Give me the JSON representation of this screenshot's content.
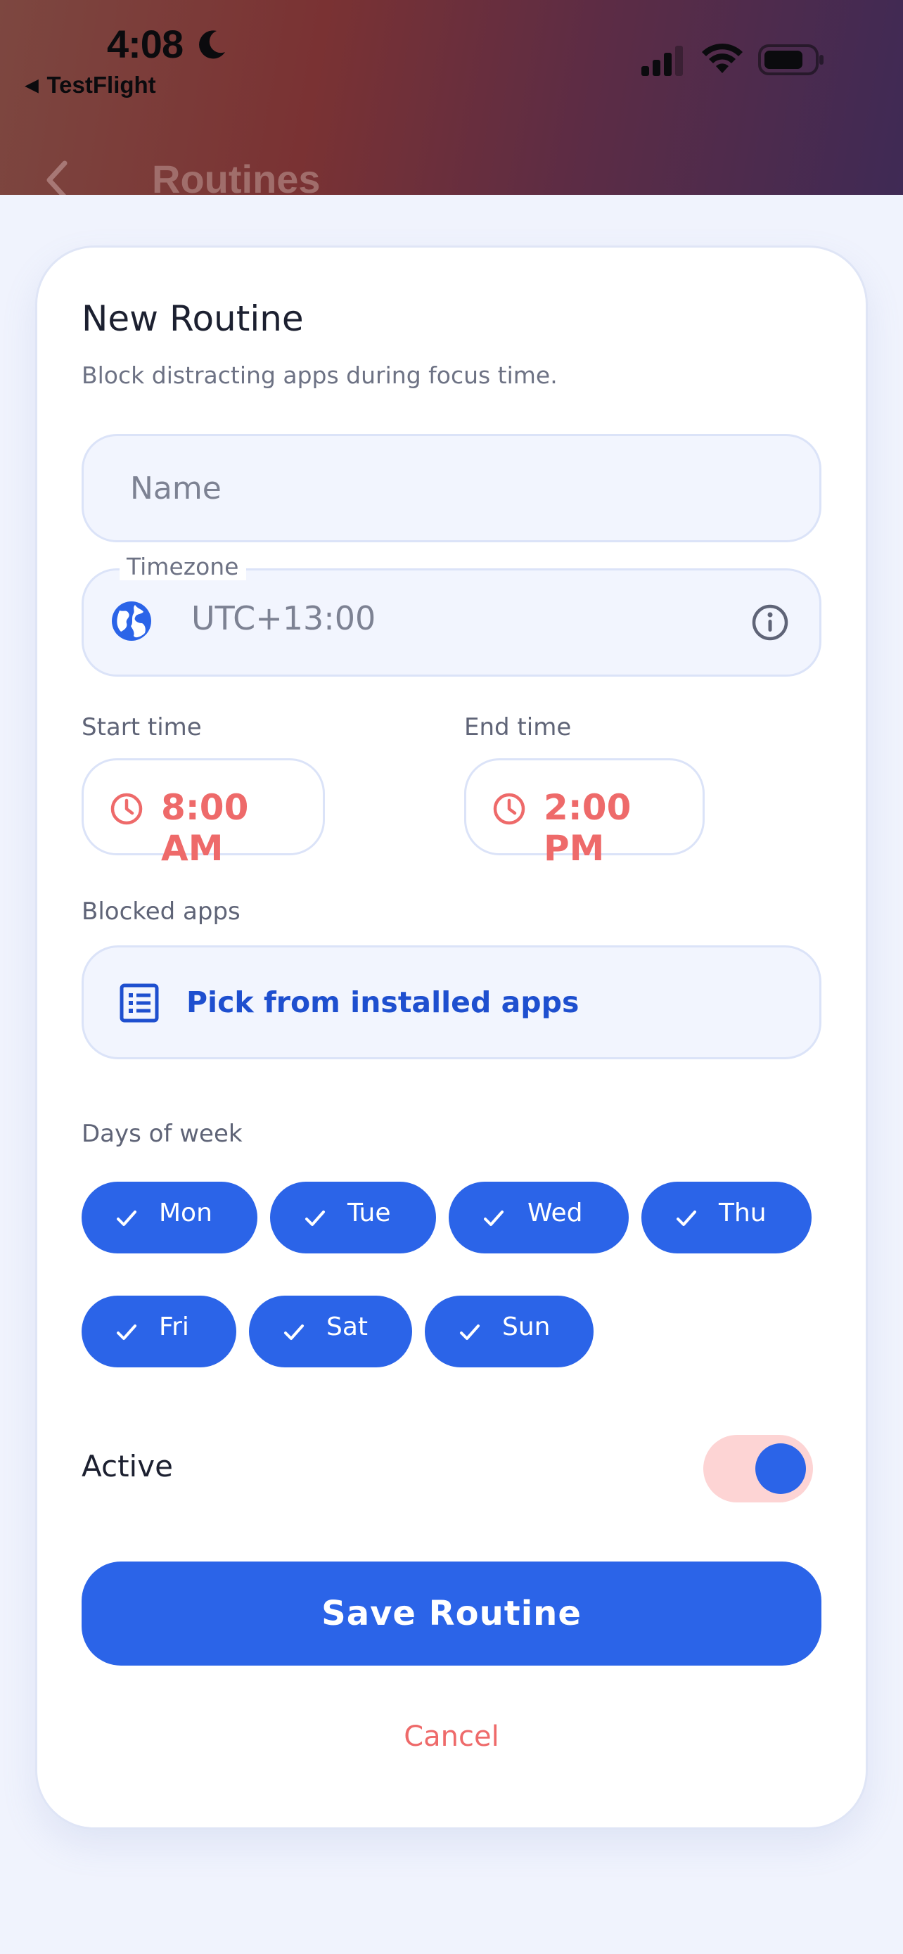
{
  "status_bar": {
    "time": "4:08",
    "back_app": "TestFlight"
  },
  "background_screen": {
    "title": "Routines"
  },
  "form": {
    "title": "New Routine",
    "subtitle": "Block distracting apps during focus time.",
    "name_placeholder": "Name",
    "name_value": "",
    "timezone_label": "Timezone",
    "timezone_value": "UTC+13:00",
    "start_time_label": "Start time",
    "start_time_value": "8:00 AM",
    "end_time_label": "End time",
    "end_time_value": "2:00 PM",
    "blocked_apps_label": "Blocked apps",
    "pick_apps_label": "Pick from installed apps",
    "days_label": "Days of week",
    "days": [
      {
        "label": "Mon",
        "selected": true
      },
      {
        "label": "Tue",
        "selected": true
      },
      {
        "label": "Wed",
        "selected": true
      },
      {
        "label": "Thu",
        "selected": true
      },
      {
        "label": "Fri",
        "selected": true
      },
      {
        "label": "Sat",
        "selected": true
      },
      {
        "label": "Sun",
        "selected": true
      }
    ],
    "active_label": "Active",
    "active_on": true,
    "save_label": "Save Routine",
    "cancel_label": "Cancel"
  },
  "colors": {
    "primary": "#2b64e8",
    "accent": "#ee6a6a",
    "toggle_track": "#fdd4d4",
    "field_bg": "#f2f5fe"
  },
  "icons": {
    "moon": "moon-icon",
    "signal": "cellular-signal-icon",
    "wifi": "wifi-icon",
    "battery": "battery-icon",
    "globe": "globe-icon",
    "info": "info-icon",
    "clock": "clock-icon",
    "list": "list-icon",
    "check": "check-icon",
    "back": "chevron-left-icon"
  }
}
